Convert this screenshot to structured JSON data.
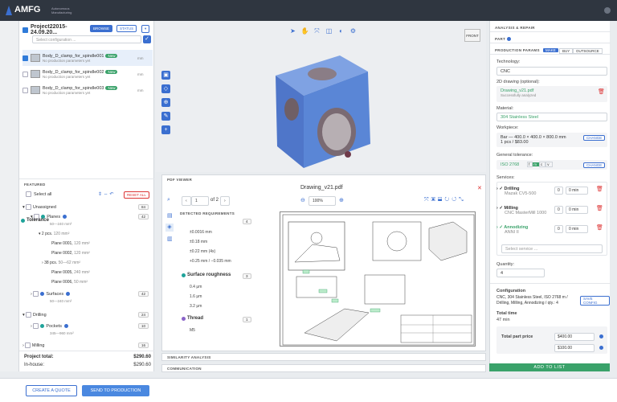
{
  "app": {
    "logo": "AMFG",
    "logo_sub": "Autonomous Manufacturing"
  },
  "project": {
    "name": "Project22015-24.09.20...",
    "browse": "BROWSE",
    "status": "STATUS",
    "config_placeholder": "Select configuration ...",
    "unit_label": "mm"
  },
  "parts": [
    {
      "name": "Body_D_clamp_for_spindle001",
      "badge": "New",
      "sub": "No production parameters yet",
      "unit": "mm"
    },
    {
      "name": "Body_D_clamp_for_spindle002",
      "badge": "New",
      "sub": "No production parameters yet",
      "unit": "mm"
    },
    {
      "name": "Body_D_clamp_for_spindle003",
      "badge": "New",
      "sub": "No production parameters yet",
      "unit": "mm"
    }
  ],
  "featured": {
    "title": "FEATURED",
    "select_all": "Select all",
    "reset_all": "RESET ALL",
    "tree": [
      {
        "label": "Unassigned",
        "count": "84"
      },
      {
        "label": "Planes",
        "count": "42",
        "sub": "50—240 mm²"
      },
      {
        "label": "2 pcs.",
        "sub": "120 mm²"
      },
      {
        "label": "Plane 0001,",
        "sub": "120 mm²"
      },
      {
        "label": "Plane 0002,",
        "sub": "120 mm²"
      },
      {
        "label": "38 pcs.",
        "sub": "50—62 mm²"
      },
      {
        "label": "Plane 0005,",
        "sub": "240 mm²"
      },
      {
        "label": "Plane 0006,",
        "sub": "50 mm²"
      },
      {
        "label": "Surfaces",
        "count": "42",
        "sub": "50—240 mm²"
      },
      {
        "label": "Drilling",
        "count": "24"
      },
      {
        "label": "Pockets",
        "count": "10",
        "sub": "345—960 mm²"
      },
      {
        "label": "Milling",
        "count": "16"
      }
    ]
  },
  "totals": {
    "project_label": "Project total:",
    "project_value": "$290.60",
    "inhouse_label": "In-house:",
    "inhouse_value": "$290.60"
  },
  "bottom": {
    "create_quote": "CREATE A QUOTE",
    "send_production": "SEND TO PRODUCTION"
  },
  "viewer": {
    "front_label": "FRONT"
  },
  "pdf": {
    "panel_title": "PDF VIEWER",
    "file_name": "Drawing_v21.pdf",
    "page": "1",
    "of_pages": "of 2",
    "zoom": "100%",
    "detected_title": "DETECTED REQUIREMENTS",
    "groups": [
      {
        "title": "Tolerance",
        "count": "4",
        "items": [
          "±0.0016 mm",
          "±0.18 mm",
          "±0.22 mm (4x)",
          "+0.25 mm / −0.035 mm"
        ]
      },
      {
        "title": "Surface roughness",
        "count": "3",
        "items": [
          "0.4 μm",
          "1.6 μm",
          "3.2 μm"
        ]
      },
      {
        "title": "Thread",
        "count": "1",
        "items": [
          "M5"
        ]
      }
    ]
  },
  "collapsed": {
    "similarity": "SIMILARITY ANALYSIS",
    "communication": "COMMUNICATION"
  },
  "right": {
    "analysis": "ANALYSIS & REPAIR",
    "part": "PART",
    "production": "PRODUCTION PARAMS",
    "make": "MAKE",
    "buy": "BUY",
    "outsource": "OUTSOURCE",
    "technology_label": "Technology:",
    "technology": "CNC",
    "drawing_label": "2D drawing (optional):",
    "drawing_file": "Drawing_v21.pdf",
    "drawing_status": "Successfully analyzed",
    "material_label": "Material:",
    "material": "304 Stainless Steel",
    "workpiece_label": "Workpiece:",
    "workpiece_line1": "Bar — 400.0 × 400.0 × 800.0 mm",
    "workpiece_line2": "1 pcs / $83.00",
    "change": "CHANGE",
    "tolerance_label": "General tolerance:",
    "tolerance": "ISO 2768",
    "tol_opts": [
      "f",
      "m",
      "c",
      "v"
    ],
    "services_label": "Services:",
    "services": [
      {
        "name": "Drilling",
        "machine": "Mazak CV5-500",
        "qty": "0",
        "min": "0 min"
      },
      {
        "name": "Milling",
        "machine": "CNC MasterMill 1000",
        "qty": "0",
        "min": "0 min"
      },
      {
        "name": "Annodizing",
        "machine": "ANNI II",
        "qty": "0",
        "min": "0 min"
      }
    ],
    "select_service": "Select service ...",
    "quantity_label": "Quantity:",
    "quantity": "4",
    "config_label": "Configuration",
    "config_text": "CNC, 304 Stainless Steel, ISO 2768 m / Drilling, Milling, Annodizing / qty.: 4",
    "save_config": "SAVE CONFIG",
    "total_time_label": "Total time",
    "total_time": "47 min",
    "price_label": "Total part price",
    "price1": "$400.00",
    "price2": "$100.00",
    "add_to_list": "ADD TO LIST"
  },
  "colors": {
    "accent": "#3b6fd0",
    "success": "#3aa26a",
    "topbar": "#2f3640",
    "model": "#5a86d6"
  }
}
